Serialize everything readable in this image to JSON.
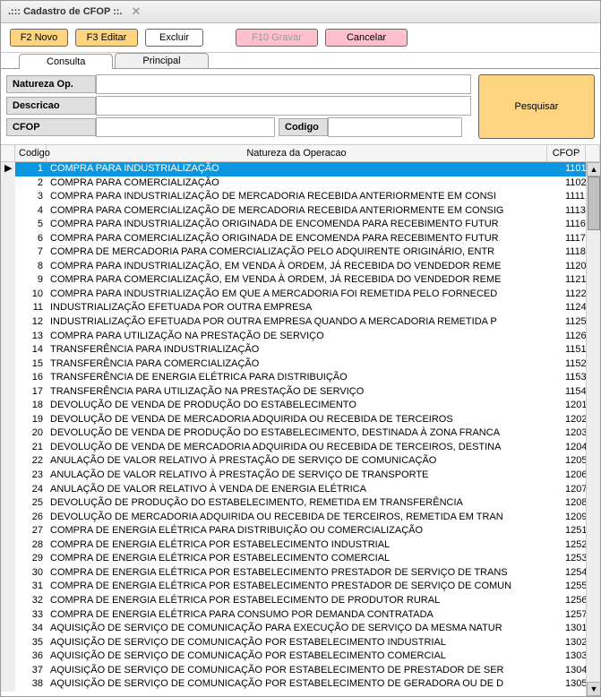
{
  "title": ".::: Cadastro de CFOP ::.",
  "toolbar": {
    "novo": "F2 Novo",
    "editar": "F3 Editar",
    "excluir": "Excluir",
    "gravar": "F10 Gravar",
    "cancelar": "Cancelar"
  },
  "tabs": {
    "consulta": "Consulta",
    "principal": "Principal"
  },
  "filters": {
    "natureza_label": "Natureza Op.",
    "descricao_label": "Descricao",
    "cfop_label": "CFOP",
    "codigo_label": "Codigo",
    "pesquisar": "Pesquisar"
  },
  "grid": {
    "headers": {
      "codigo": "Codigo",
      "natureza": "Natureza da Operacao",
      "cfop": "CFOP"
    },
    "rows": [
      {
        "codigo": "1",
        "natureza": "COMPRA PARA INDUSTRIALIZAÇÃO",
        "cfop": "1101",
        "selected": true
      },
      {
        "codigo": "2",
        "natureza": "COMPRA PARA COMERCIALIZAÇÃO",
        "cfop": "1102"
      },
      {
        "codigo": "3",
        "natureza": "COMPRA PARA INDUSTRIALIZAÇÃO DE MERCADORIA RECEBIDA ANTERIORMENTE EM CONSI",
        "cfop": "1111"
      },
      {
        "codigo": "4",
        "natureza": "COMPRA PARA COMERCIALIZAÇÃO DE MERCADORIA RECEBIDA ANTERIORMENTE EM CONSIG",
        "cfop": "1113"
      },
      {
        "codigo": "5",
        "natureza": "COMPRA PARA INDUSTRIALIZAÇÃO ORIGINADA DE ENCOMENDA PARA RECEBIMENTO FUTUR",
        "cfop": "1116"
      },
      {
        "codigo": "6",
        "natureza": "COMPRA PARA COMERCIALIZAÇÃO ORIGINADA DE ENCOMENDA PARA RECEBIMENTO FUTUR",
        "cfop": "1117"
      },
      {
        "codigo": "7",
        "natureza": "COMPRA DE MERCADORIA PARA COMERCIALIZAÇÃO PELO ADQUIRENTE ORIGINÁRIO, ENTR",
        "cfop": "1118"
      },
      {
        "codigo": "8",
        "natureza": "COMPRA PARA INDUSTRIALIZAÇÃO, EM VENDA À ORDEM, JÁ RECEBIDA DO VENDEDOR REME",
        "cfop": "1120"
      },
      {
        "codigo": "9",
        "natureza": "COMPRA PARA COMERCIALIZAÇÃO, EM VENDA À ORDEM, JÁ RECEBIDA DO VENDEDOR REME",
        "cfop": "1121"
      },
      {
        "codigo": "10",
        "natureza": "COMPRA PARA INDUSTRIALIZAÇÃO EM QUE A MERCADORIA FOI REMETIDA PELO FORNECED",
        "cfop": "1122"
      },
      {
        "codigo": "11",
        "natureza": "INDUSTRIALIZAÇÃO EFETUADA POR OUTRA EMPRESA",
        "cfop": "1124"
      },
      {
        "codigo": "12",
        "natureza": "INDUSTRIALIZAÇÃO EFETUADA POR OUTRA EMPRESA QUANDO A MERCADORIA REMETIDA P",
        "cfop": "1125"
      },
      {
        "codigo": "13",
        "natureza": "COMPRA PARA UTILIZAÇÃO NA PRESTAÇÃO DE SERVIÇO",
        "cfop": "1126"
      },
      {
        "codigo": "14",
        "natureza": "TRANSFERÊNCIA PARA INDUSTRIALIZAÇÃO",
        "cfop": "1151"
      },
      {
        "codigo": "15",
        "natureza": "TRANSFERÊNCIA PARA COMERCIALIZAÇÃO",
        "cfop": "1152"
      },
      {
        "codigo": "16",
        "natureza": "TRANSFERÊNCIA DE ENERGIA ELÉTRICA PARA DISTRIBUIÇÃO",
        "cfop": "1153"
      },
      {
        "codigo": "17",
        "natureza": "TRANSFERÊNCIA PARA UTILIZAÇÃO NA PRESTAÇÃO DE SERVIÇO",
        "cfop": "1154"
      },
      {
        "codigo": "18",
        "natureza": "DEVOLUÇÃO DE VENDA DE PRODUÇÃO DO ESTABELECIMENTO",
        "cfop": "1201"
      },
      {
        "codigo": "19",
        "natureza": "DEVOLUÇÃO DE VENDA DE MERCADORIA ADQUIRIDA OU RECEBIDA DE TERCEIROS",
        "cfop": "1202"
      },
      {
        "codigo": "20",
        "natureza": "DEVOLUÇÃO DE VENDA DE PRODUÇÃO DO ESTABELECIMENTO, DESTINADA À ZONA FRANCA",
        "cfop": "1203"
      },
      {
        "codigo": "21",
        "natureza": "DEVOLUÇÃO DE VENDA DE MERCADORIA ADQUIRIDA OU RECEBIDA DE TERCEIROS, DESTINA",
        "cfop": "1204"
      },
      {
        "codigo": "22",
        "natureza": "ANULAÇÃO DE VALOR RELATIVO À PRESTAÇÃO DE SERVIÇO DE COMUNICAÇÃO",
        "cfop": "1205"
      },
      {
        "codigo": "23",
        "natureza": "ANULAÇÃO DE VALOR RELATIVO À PRESTAÇÃO DE SERVIÇO DE TRANSPORTE",
        "cfop": "1206"
      },
      {
        "codigo": "24",
        "natureza": "ANULAÇÃO DE VALOR RELATIVO À VENDA DE ENERGIA ELÉTRICA",
        "cfop": "1207"
      },
      {
        "codigo": "25",
        "natureza": "DEVOLUÇÃO DE PRODUÇÃO DO ESTABELECIMENTO, REMETIDA EM TRANSFERÊNCIA",
        "cfop": "1208"
      },
      {
        "codigo": "26",
        "natureza": "DEVOLUÇÃO DE MERCADORIA ADQUIRIDA OU RECEBIDA DE TERCEIROS, REMETIDA EM TRAN",
        "cfop": "1209"
      },
      {
        "codigo": "27",
        "natureza": "COMPRA DE ENERGIA ELÉTRICA PARA DISTRIBUIÇÃO OU COMERCIALIZAÇÃO",
        "cfop": "1251"
      },
      {
        "codigo": "28",
        "natureza": "COMPRA DE ENERGIA ELÉTRICA POR ESTABELECIMENTO INDUSTRIAL",
        "cfop": "1252"
      },
      {
        "codigo": "29",
        "natureza": "COMPRA DE ENERGIA ELÉTRICA POR ESTABELECIMENTO COMERCIAL",
        "cfop": "1253"
      },
      {
        "codigo": "30",
        "natureza": "COMPRA DE ENERGIA ELÉTRICA POR ESTABELECIMENTO PRESTADOR DE SERVIÇO DE TRANS",
        "cfop": "1254"
      },
      {
        "codigo": "31",
        "natureza": "COMPRA DE ENERGIA ELÉTRICA POR ESTABELECIMENTO PRESTADOR DE SERVIÇO DE COMUN",
        "cfop": "1255"
      },
      {
        "codigo": "32",
        "natureza": "COMPRA DE ENERGIA ELÉTRICA POR ESTABELECIMENTO DE PRODUTOR RURAL",
        "cfop": "1256"
      },
      {
        "codigo": "33",
        "natureza": "COMPRA DE ENERGIA ELÉTRICA PARA CONSUMO POR DEMANDA CONTRATADA",
        "cfop": "1257"
      },
      {
        "codigo": "34",
        "natureza": "AQUISIÇÃO DE SERVIÇO DE COMUNICAÇÃO PARA EXECUÇÃO DE SERVIÇO DA MESMA NATUR",
        "cfop": "1301"
      },
      {
        "codigo": "35",
        "natureza": "AQUISIÇÃO DE SERVIÇO DE COMUNICAÇÃO POR ESTABELECIMENTO INDUSTRIAL",
        "cfop": "1302"
      },
      {
        "codigo": "36",
        "natureza": "AQUISIÇÃO DE SERVIÇO DE COMUNICAÇÃO POR ESTABELECIMENTO COMERCIAL",
        "cfop": "1303"
      },
      {
        "codigo": "37",
        "natureza": "AQUISIÇÃO DE SERVIÇO DE COMUNICAÇÃO POR ESTABELECIMENTO DE PRESTADOR DE SER",
        "cfop": "1304"
      },
      {
        "codigo": "38",
        "natureza": "AQUISIÇÃO DE SERVIÇO DE COMUNICAÇÃO POR ESTABELECIMENTO DE GERADORA OU DE D",
        "cfop": "1305"
      }
    ]
  }
}
